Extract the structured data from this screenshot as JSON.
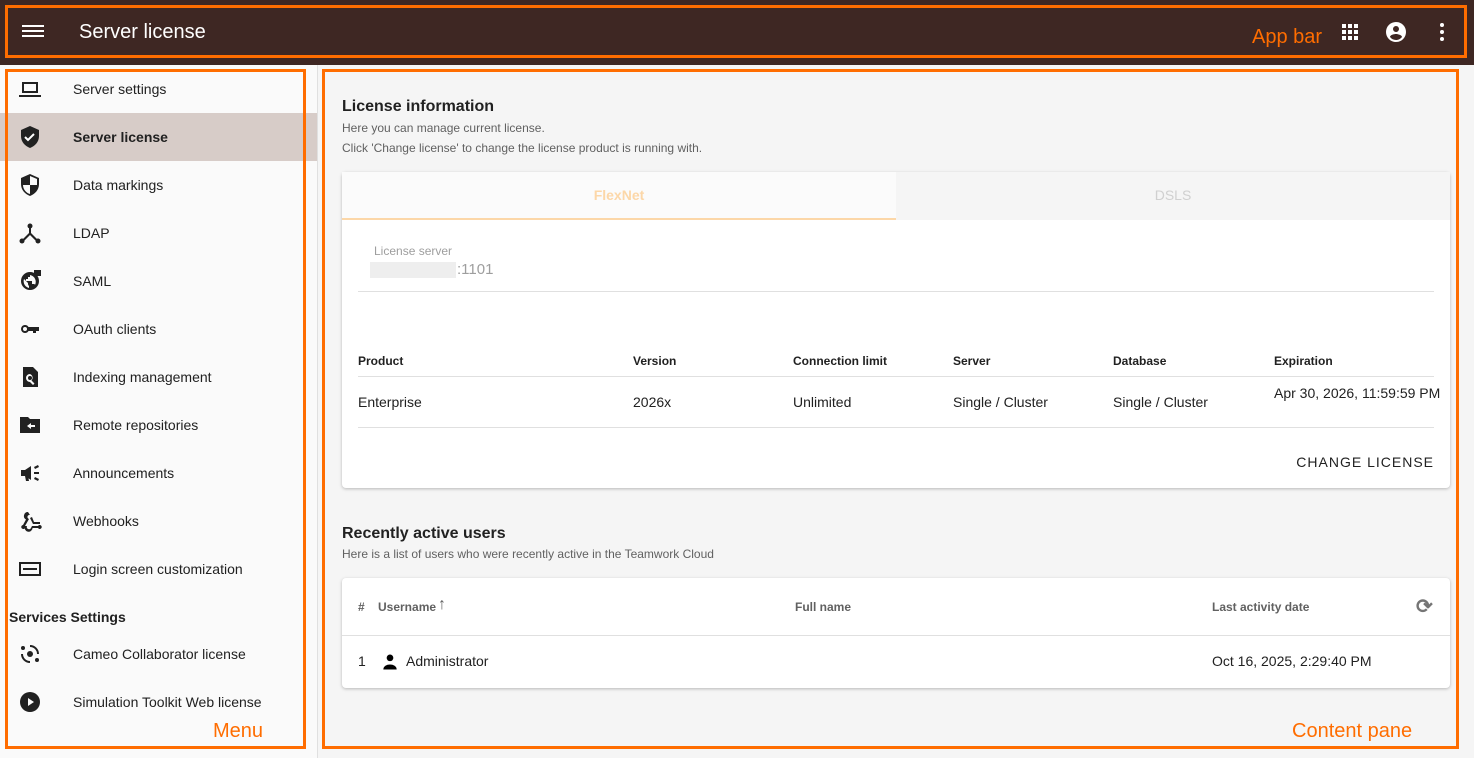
{
  "appbar": {
    "title": "Server license"
  },
  "menu": {
    "items": [
      {
        "label": "Server settings",
        "icon": "laptop-icon"
      },
      {
        "label": "Server license",
        "icon": "verified-shield-icon"
      },
      {
        "label": "Data markings",
        "icon": "shield-icon"
      },
      {
        "label": "LDAP",
        "icon": "hub-icon"
      },
      {
        "label": "SAML",
        "icon": "globe-lock-icon"
      },
      {
        "label": "OAuth clients",
        "icon": "key-icon"
      },
      {
        "label": "Indexing management",
        "icon": "find-in-page-icon"
      },
      {
        "label": "Remote repositories",
        "icon": "folder-arrow-icon"
      },
      {
        "label": "Announcements",
        "icon": "megaphone-icon"
      },
      {
        "label": "Webhooks",
        "icon": "webhook-icon"
      },
      {
        "label": "Login screen customization",
        "icon": "panel-icon"
      }
    ],
    "section": "Services Settings",
    "services": [
      {
        "label": "Cameo Collaborator license",
        "icon": "cycle-icon"
      },
      {
        "label": "Simulation Toolkit Web license",
        "icon": "play-circle-icon"
      }
    ]
  },
  "license": {
    "title": "License information",
    "desc1": "Here you can manage current license.",
    "desc2": "Click 'Change license' to change the license product is running with.",
    "tabs": [
      "FlexNet",
      "DSLS"
    ],
    "server_label": "License server",
    "server_port": ":1101",
    "headers": [
      "Product",
      "Version",
      "Connection limit",
      "Server",
      "Database",
      "Expiration"
    ],
    "row": [
      "Enterprise",
      "2026x",
      "Unlimited",
      "Single / Cluster",
      "Single / Cluster",
      "Apr 30, 2026, 11:59:59 PM"
    ],
    "change": "CHANGE LICENSE"
  },
  "users": {
    "title": "Recently active users",
    "desc": "Here is a list of users who were recently active in the Teamwork Cloud",
    "headers": [
      "#",
      "Username",
      "Full name",
      "Last activity date"
    ],
    "rows": [
      {
        "n": "1",
        "username": "Administrator",
        "fullname": "",
        "date": "Oct 16, 2025, 2:29:40 PM"
      }
    ]
  },
  "annotations": {
    "appbar": "App bar",
    "menu": "Menu",
    "content": "Content pane"
  },
  "colors": {
    "appbar": "#3e2723",
    "active": "#d7ccc8",
    "annotation": "#ff6d00",
    "tab_accent": "#fcd7a8"
  }
}
